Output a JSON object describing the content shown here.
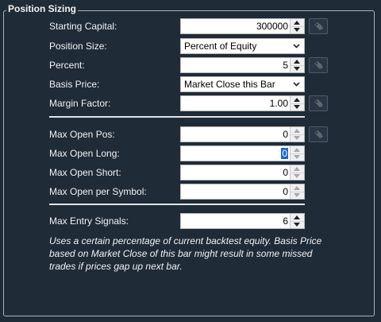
{
  "group": {
    "title": "Position Sizing"
  },
  "fields": {
    "starting_capital": {
      "label": "Starting Capital:",
      "value": "300000"
    },
    "position_size": {
      "label": "Position Size:",
      "value": "Percent of Equity"
    },
    "percent": {
      "label": "Percent:",
      "value": "5"
    },
    "basis_price": {
      "label": "Basis Price:",
      "value": "Market Close this Bar"
    },
    "margin_factor": {
      "label": "Margin Factor:",
      "value": "1.00"
    },
    "max_open_pos": {
      "label": "Max Open Pos:",
      "value": "0"
    },
    "max_open_long": {
      "label": "Max Open Long:",
      "value": "0"
    },
    "max_open_short": {
      "label": "Max Open Short:",
      "value": "0"
    },
    "max_open_per_symbol": {
      "label": "Max Open per Symbol:",
      "value": "0"
    },
    "max_entry_signals": {
      "label": "Max Entry Signals:",
      "value": "6"
    }
  },
  "description": "Uses a certain percentage of current backtest equity. Basis Price based on Market Close of this bar might result in some missed trades if prices gap up next bar.",
  "icons": {
    "optimize_button": "optimize-icon",
    "spin_arrows": "spin-arrows-icon",
    "dropdown": "chevron-down-icon"
  },
  "colors": {
    "background": "#1f2b37",
    "group_border": "#aab3bb",
    "selection": "#1e68c8"
  }
}
